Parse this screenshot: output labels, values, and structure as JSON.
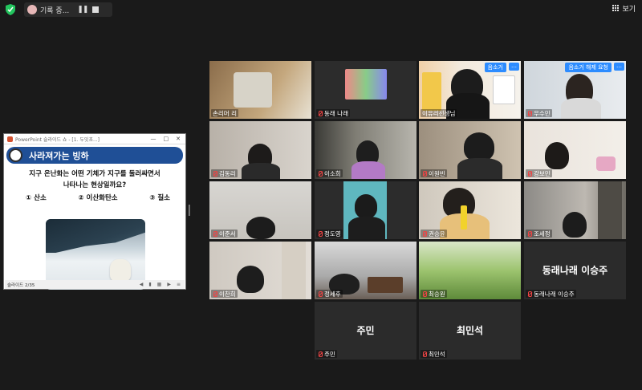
{
  "topbar": {
    "recording_label": "기록 중...",
    "view_label": "보기"
  },
  "share": {
    "window_title": "PowerPoint 슬라이드 쇼 - [1. 두잇초...]",
    "slide": {
      "title": "사라져가는 빙하",
      "question_line1": "지구 온난화는 어떤 기체가 지구를 둘러싸면서",
      "question_line2": "나타나는 현상일까요?",
      "options": [
        "① 산소",
        "② 이산화탄소",
        "③ 질소"
      ]
    },
    "status_text": "슬라이드 2/35"
  },
  "participants": [
    {
      "name": "손리머 리"
    },
    {
      "name": "동래 나래"
    },
    {
      "name": "이유리선생님",
      "buttons": [
        "음소거",
        "…"
      ]
    },
    {
      "name": "우수민",
      "buttons": [
        "음소거 해제 요청",
        "…"
      ]
    },
    {
      "name": "김동리"
    },
    {
      "name": "이소희"
    },
    {
      "name": "이원빈"
    },
    {
      "name": "강보민"
    },
    {
      "name": "이준서"
    },
    {
      "name": "정도영"
    },
    {
      "name": "권승윤"
    },
    {
      "name": "조세정"
    },
    {
      "name": "이찬희"
    },
    {
      "name": "정세후"
    },
    {
      "name": "최승원"
    },
    {
      "name": "동래나래 이승주",
      "big": "동래나래 이승주"
    },
    {
      "name": "주민",
      "big": "주민"
    },
    {
      "name": "최민석",
      "big": "최민석"
    }
  ],
  "colors": {
    "background": "#1a1a1a",
    "accent": "#2d8cff",
    "speaker_highlight": "#f0d84b",
    "slide_header": "#1f4f96"
  }
}
